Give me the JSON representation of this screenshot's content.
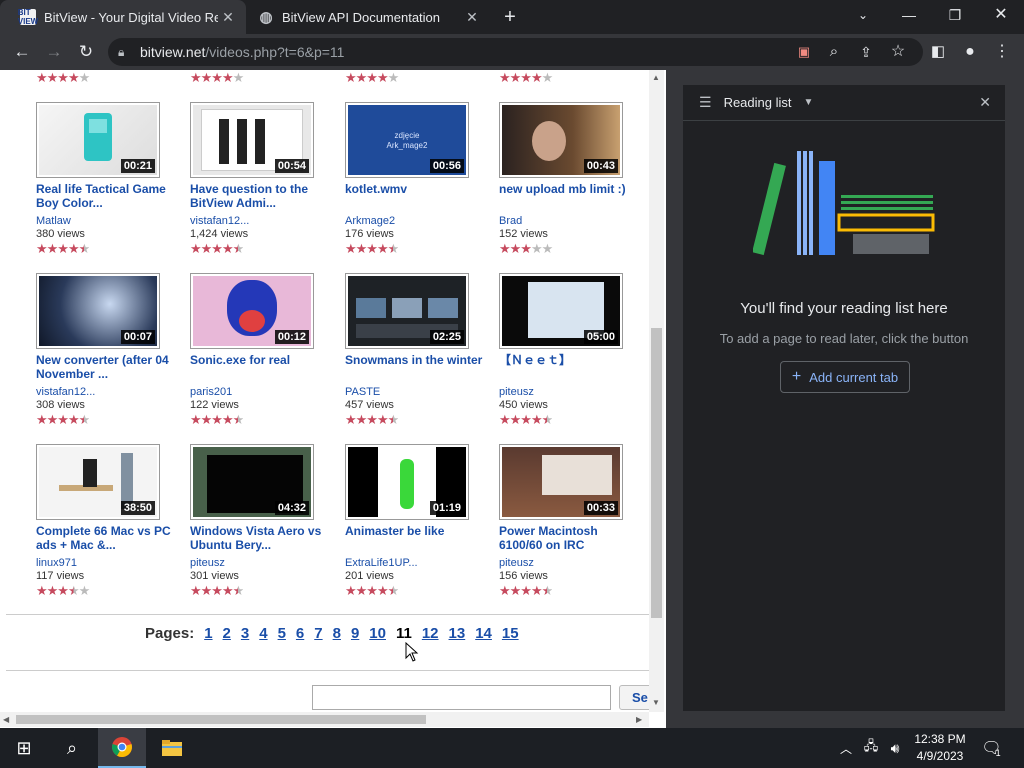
{
  "tabs": [
    {
      "title": "BitView - Your Digital Video Repo",
      "favicon": "BIT VIEW"
    },
    {
      "title": "BitView API Documentation",
      "favicon": "globe-icon"
    }
  ],
  "new_tab": "+",
  "url": {
    "host": "bitview.net",
    "path": "/videos.php?t=6&p=11"
  },
  "videos": [
    {
      "title": "Real life Tactical Game Boy Color...",
      "user": "Matlaw",
      "views": "380 views",
      "duration": "00:21",
      "stars": 4.5
    },
    {
      "title": "Have question to the BitView Admi...",
      "user": "vistafan12...",
      "views": "1,424 views",
      "duration": "00:54",
      "stars": 4.5
    },
    {
      "title": "kotlet.wmv",
      "user": "Arkmage2",
      "views": "176 views",
      "duration": "00:56",
      "stars": 4.5,
      "thumb_text": [
        "zdjęcie",
        "Ark_mage2"
      ]
    },
    {
      "title": "new upload mb limit :)",
      "user": "Brad",
      "views": "152 views",
      "duration": "00:43",
      "stars": 3
    },
    {
      "title": "New converter (after 04 November ...",
      "user": "vistafan12...",
      "views": "308 views",
      "duration": "00:07",
      "stars": 4.5
    },
    {
      "title": "Sonic.exe for real",
      "user": "paris201",
      "views": "122 views",
      "duration": "00:12",
      "stars": 4.5
    },
    {
      "title": "Snowmans in the winter",
      "user": "PASTE",
      "views": "457 views",
      "duration": "02:25",
      "stars": 4.5
    },
    {
      "title": "【Ｎｅｅｔ】",
      "user": "piteusz",
      "views": "450 views",
      "duration": "05:00",
      "stars": 4.5
    },
    {
      "title": "Complete 66 Mac vs PC ads + Mac &...",
      "user": "linux971",
      "views": "117 views",
      "duration": "38:50",
      "stars": 3.5
    },
    {
      "title": "Windows Vista Aero vs Ubuntu Bery...",
      "user": "piteusz",
      "views": "301 views",
      "duration": "04:32",
      "stars": 4.5
    },
    {
      "title": "Animaster be like",
      "user": "ExtraLife1UP...",
      "views": "201 views",
      "duration": "01:19",
      "stars": 4.5
    },
    {
      "title": "Power Macintosh 6100/60 on IRC",
      "user": "piteusz",
      "views": "156 views",
      "duration": "00:33",
      "stars": 4.5
    }
  ],
  "pager": {
    "label": "Pages:",
    "pages": [
      "1",
      "2",
      "3",
      "4",
      "5",
      "6",
      "7",
      "8",
      "9",
      "10",
      "11",
      "12",
      "13",
      "14",
      "15"
    ],
    "current": "11"
  },
  "search_button": "Se",
  "reading_list": {
    "title": "Reading list",
    "empty_title": "You'll find your reading list here",
    "empty_sub": "To add a page to read later, click the button",
    "add_button": "Add current tab"
  },
  "clock": {
    "time": "12:38 PM",
    "date": "4/9/2023"
  },
  "notification_count": "1",
  "colors": {
    "link": "#1a4ea8",
    "star": "#c64a5e",
    "accent_blue": "#8ab4f8"
  }
}
